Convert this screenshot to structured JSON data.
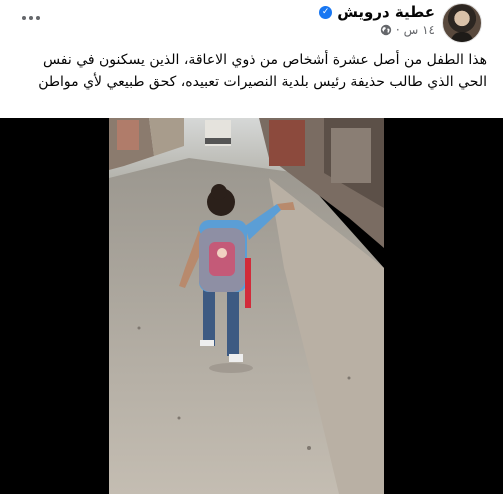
{
  "post": {
    "author_name": "عطية درويش",
    "timestamp": "١٤ س",
    "separator": "·",
    "text": "هذا الطفل من أصل عشرة أشخاص من ذوي الاعاقة، الذين يسكنون في نفس الحي الذي طالب حذيفة رئيس بلدية النصيرات تعبيده، كحق طبيعي لأي مواطن",
    "privacy_icon": "globe-icon",
    "verified_icon": "verified-badge-icon",
    "more_icon": "more-options-icon"
  },
  "video": {
    "background": "#000000",
    "content": "child-walking-with-backpack"
  },
  "colors": {
    "verified": "#1877f2",
    "secondary_text": "#65676b",
    "primary_text": "#050505"
  }
}
